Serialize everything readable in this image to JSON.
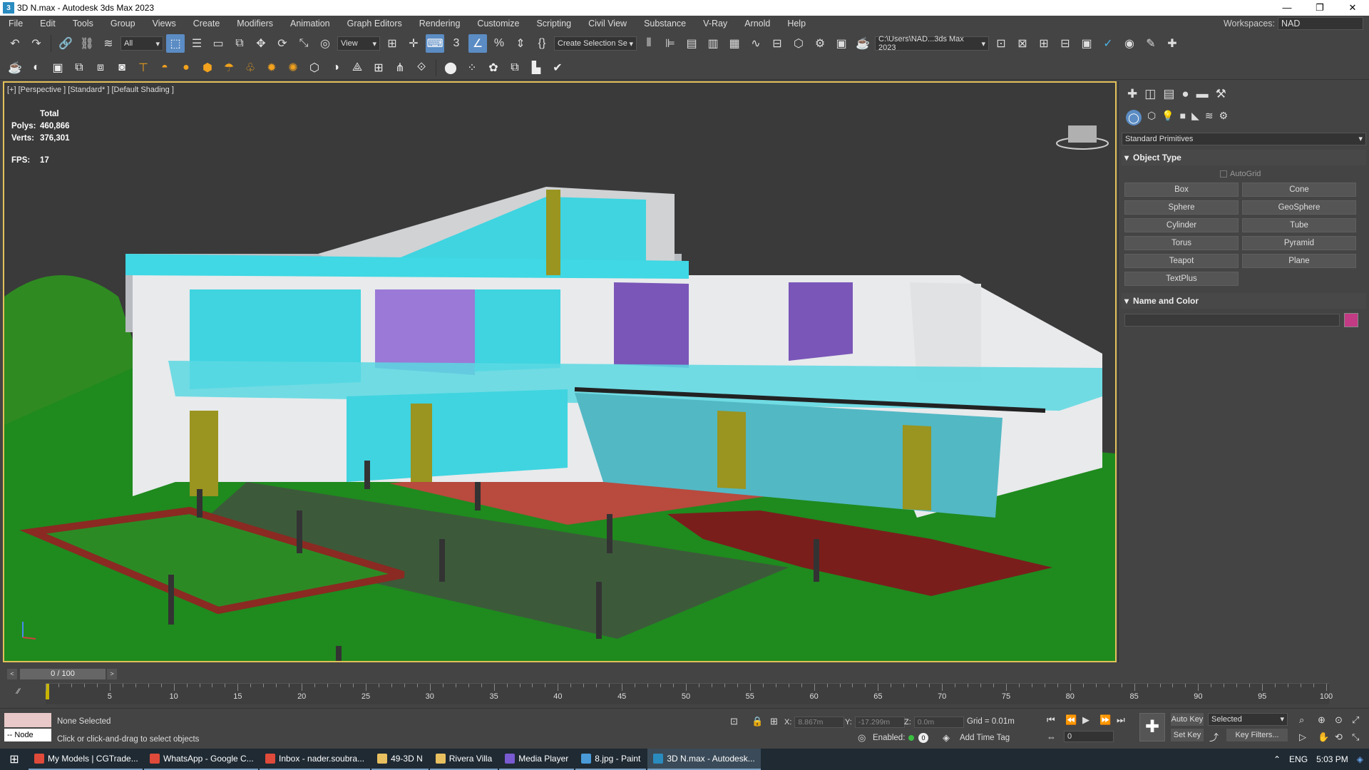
{
  "window": {
    "title": "3D N.max - Autodesk 3ds Max 2023",
    "minimize": "—",
    "restore": "❐",
    "close": "✕"
  },
  "menu": [
    "File",
    "Edit",
    "Tools",
    "Group",
    "Views",
    "Create",
    "Modifiers",
    "Animation",
    "Graph Editors",
    "Rendering",
    "Customize",
    "Scripting",
    "Civil View",
    "Substance",
    "V-Ray",
    "Arnold",
    "Help"
  ],
  "workspaces": {
    "label": "Workspaces:",
    "value": "NAD"
  },
  "toolbar": {
    "filter_value": "All",
    "refcoord_value": "View",
    "selection_set_placeholder": "Create Selection Se",
    "project_path": "C:\\Users\\NAD...3ds Max 2023"
  },
  "viewport": {
    "label": "[+] [Perspective ] [Standard* ] [Default Shading ]",
    "stats": {
      "total_label": "Total",
      "polys_label": "Polys:",
      "polys": "460,866",
      "verts_label": "Verts:",
      "verts": "376,301",
      "fps_label": "FPS:",
      "fps": "17"
    }
  },
  "command_panel": {
    "category": "Standard Primitives",
    "object_type_title": "Object Type",
    "autogrid": "AutoGrid",
    "buttons": [
      "Box",
      "Cone",
      "Sphere",
      "GeoSphere",
      "Cylinder",
      "Tube",
      "Torus",
      "Pyramid",
      "Teapot",
      "Plane",
      "TextPlus"
    ],
    "name_color_title": "Name and Color",
    "object_color": "#c23b84"
  },
  "timeline": {
    "frame_readout": "0 / 100",
    "ticks": [
      "5",
      "10",
      "15",
      "20",
      "25",
      "30",
      "35",
      "40",
      "45",
      "50",
      "55",
      "60",
      "65",
      "70",
      "75",
      "80",
      "85",
      "90",
      "95",
      "100"
    ]
  },
  "status": {
    "selection": "None Selected",
    "prompt": "Click or click-and-drag to select objects",
    "node": "-- Node",
    "x_label": "X:",
    "x": "8.867m",
    "y_label": "Y:",
    "y": "-17.299m",
    "z_label": "Z:",
    "z": "0.0m",
    "grid": "Grid = 0.01m",
    "enabled": "Enabled:",
    "add_time_tag": "Add Time Tag",
    "auto_key": "Auto Key",
    "set_key": "Set Key",
    "selected": "Selected",
    "key_filters": "Key Filters...",
    "frame": "0"
  },
  "taskbar": {
    "items": [
      {
        "label": "My Models | CGTrade...",
        "color": "#e04a3a"
      },
      {
        "label": "WhatsApp - Google C...",
        "color": "#e04a3a"
      },
      {
        "label": "Inbox - nader.soubra...",
        "color": "#e04a3a"
      },
      {
        "label": "49-3D N",
        "color": "#e8c060"
      },
      {
        "label": "Rivera Villa",
        "color": "#e8c060"
      },
      {
        "label": "Media Player",
        "color": "#7a5ad0"
      },
      {
        "label": "8.jpg - Paint",
        "color": "#4a9ad8"
      },
      {
        "label": "3D N.max - Autodesk...",
        "color": "#2a8bbf"
      }
    ],
    "lang": "ENG",
    "time": "5:03 PM"
  }
}
